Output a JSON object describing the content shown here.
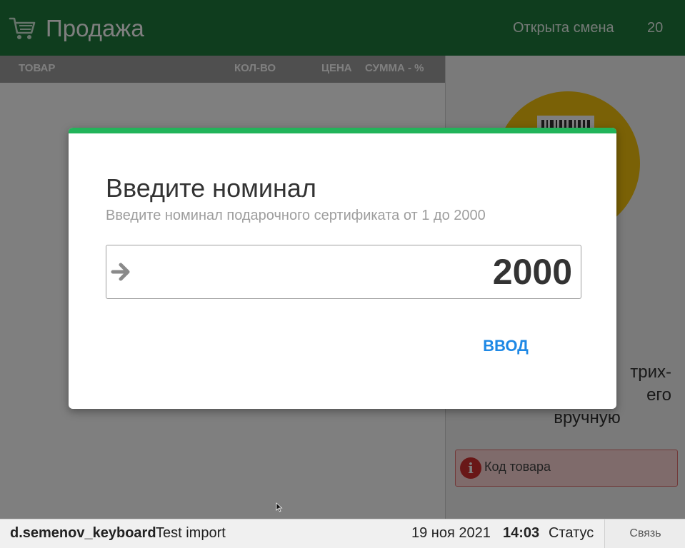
{
  "header": {
    "title": "Продажа",
    "shift_text": "Открыта смена",
    "shift_number": "20",
    "bg_color": "#1f7a3c"
  },
  "columns": {
    "item": "ТОВАР",
    "qty": "КОЛ-ВО",
    "price": "ЦЕНА",
    "sum": "СУММА - %"
  },
  "right_panel": {
    "scan_hint_line1": "трих-",
    "scan_hint_line2": "его",
    "scan_hint_line3": "вручную",
    "code_placeholder": "Код товара"
  },
  "modal": {
    "title": "Введите номинал",
    "subtitle": "Введите номинал подарочного сертификата от 1 до 2000",
    "amount_value": "2000",
    "enter_label": "ВВОД",
    "accent_color": "#22b45a",
    "button_color": "#1e88e5"
  },
  "footer": {
    "user": "d.semenov_keyboard",
    "import_label": "Test import",
    "date": "19 ноя 2021",
    "time": "14:03",
    "status": "Статус",
    "link_label": "Связь"
  },
  "icons": {
    "cart": "shopping-cart-icon",
    "barcode": "barcode-icon",
    "info": "info-icon",
    "arrow": "arrow-right-icon",
    "cursor": "mouse-cursor-icon"
  }
}
